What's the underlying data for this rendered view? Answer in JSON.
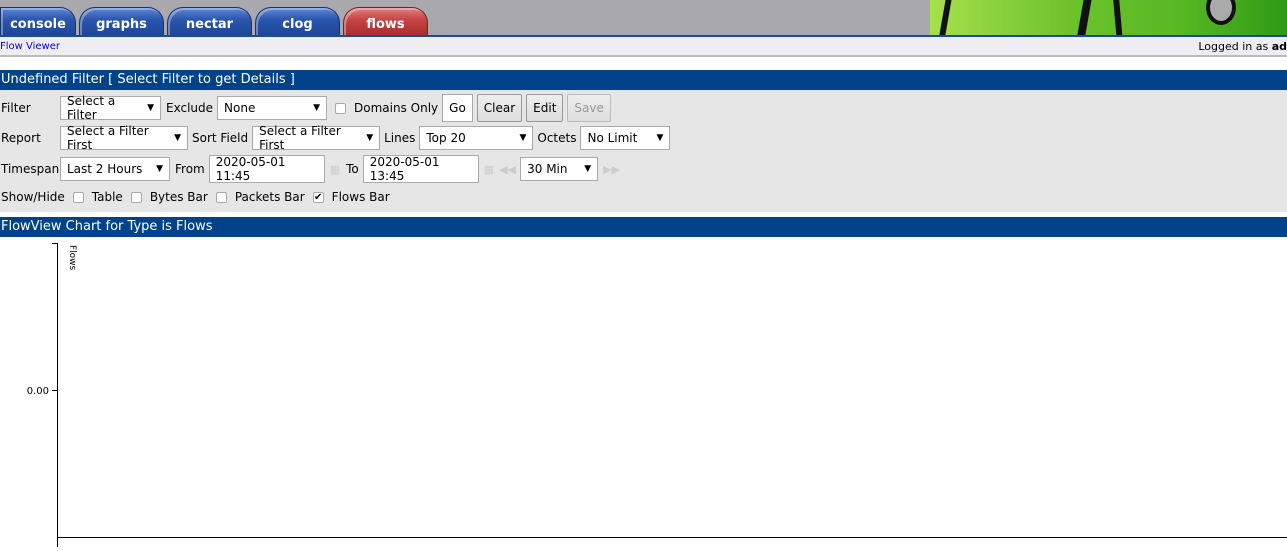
{
  "tabs": [
    {
      "label": "console"
    },
    {
      "label": "graphs"
    },
    {
      "label": "nectar"
    },
    {
      "label": "clog"
    },
    {
      "label": "flows",
      "active": true
    }
  ],
  "subheader": {
    "breadcrumb": "Flow Viewer",
    "logged_in_prefix": "Logged in as ",
    "user": "ad"
  },
  "filter_header": "Undefined Filter [ Select Filter to get Details ]",
  "form": {
    "filter": {
      "label": "Filter",
      "value": "Select a Filter"
    },
    "exclude": {
      "label": "Exclude",
      "value": "None"
    },
    "domains_only": {
      "label": "Domains Only",
      "checked": false
    },
    "buttons": {
      "go": "Go",
      "clear": "Clear",
      "edit": "Edit",
      "save": "Save"
    },
    "report": {
      "label": "Report",
      "value": "Select a Filter First"
    },
    "sort_field": {
      "label": "Sort Field",
      "value": "Select a Filter First"
    },
    "lines": {
      "label": "Lines",
      "value": "Top 20"
    },
    "octets": {
      "label": "Octets",
      "value": "No Limit"
    },
    "timespan": {
      "label": "Timespan",
      "value": "Last 2 Hours"
    },
    "from": {
      "label": "From",
      "value": "2020-05-01 11:45"
    },
    "to": {
      "label": "To",
      "value": "2020-05-01 13:45"
    },
    "shift": {
      "value": "30 Min"
    },
    "showhide": {
      "label": "Show/Hide",
      "table": "Table",
      "bytes": "Bytes Bar",
      "packets": "Packets Bar",
      "flows": "Flows Bar",
      "flows_checked": true
    }
  },
  "chart_header": "FlowView Chart for Type is Flows",
  "chart_data": {
    "type": "bar",
    "ylabel": "Flows",
    "yticks": [
      "0.00"
    ],
    "categories": [],
    "values": []
  },
  "colors": {
    "header_blue": "#00438a",
    "tab_blue": "#2a56ad",
    "tab_active_red": "#c64545"
  }
}
